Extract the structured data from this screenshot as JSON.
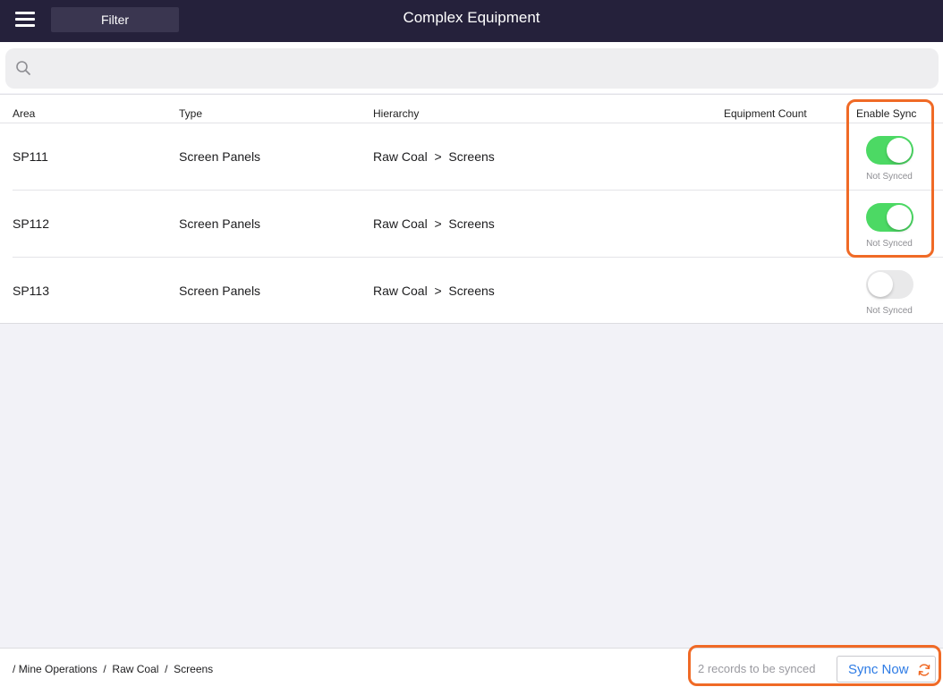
{
  "header": {
    "title": "Complex Equipment",
    "filter_label": "Filter",
    "menu_icon": "hamburger-menu-icon"
  },
  "search": {
    "placeholder": "",
    "value": "",
    "icon": "search-icon"
  },
  "table": {
    "columns": {
      "area": "Area",
      "type": "Type",
      "hierarchy": "Hierarchy",
      "equipment_count": "Equipment Count",
      "enable_sync": "Enable Sync"
    },
    "rows": [
      {
        "area": "SP111",
        "type": "Screen Panels",
        "hierarchy": "Raw Coal  >  Screens",
        "equipment_count": "",
        "sync_enabled": true,
        "status": "Not Synced"
      },
      {
        "area": "SP112",
        "type": "Screen Panels",
        "hierarchy": "Raw Coal  >  Screens",
        "equipment_count": "",
        "sync_enabled": true,
        "status": "Not Synced"
      },
      {
        "area": "SP113",
        "type": "Screen Panels",
        "hierarchy": "Raw Coal  >  Screens",
        "equipment_count": "",
        "sync_enabled": false,
        "status": "Not Synced"
      }
    ]
  },
  "footer": {
    "breadcrumb": [
      "Mine Operations",
      "Raw Coal",
      "Screens"
    ],
    "separator": "/",
    "pending_text": "2 records to be synced",
    "sync_now_label": "Sync Now",
    "sync_icon": "sync-refresh-icon"
  },
  "colors": {
    "header_bg": "#25213b",
    "toggle_on": "#4cd964",
    "highlight": "#f06a26",
    "link_blue": "#2d7be5"
  }
}
